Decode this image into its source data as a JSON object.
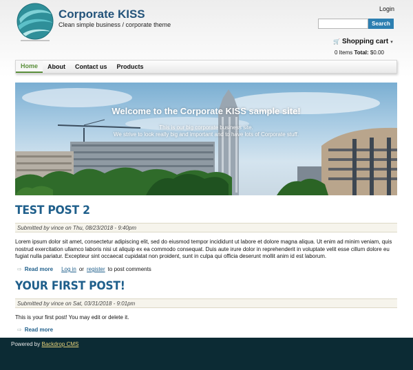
{
  "header": {
    "site_name": "Corporate KISS",
    "slogan": "Clean simple business / corporate theme",
    "login_label": "Login",
    "search": {
      "placeholder": "",
      "button_label": "Search"
    },
    "cart": {
      "title": "Shopping cart",
      "items_text": "0 Items",
      "total_label": "Total:",
      "total_value": "$0.00"
    },
    "icons": {
      "logo": "globe-logo",
      "cart": "cart-icon",
      "cart_toggle": "chevron-down-icon"
    }
  },
  "nav": {
    "items": [
      {
        "label": "Home",
        "active": true
      },
      {
        "label": "About",
        "active": false
      },
      {
        "label": "Contact us",
        "active": false
      },
      {
        "label": "Products",
        "active": false
      }
    ]
  },
  "hero": {
    "title": "Welcome to the Corporate KISS sample site!",
    "line1": "This is our big corporate business site.",
    "line2": "We strive to look really big and important and to have lots of Corporate stuff."
  },
  "posts": [
    {
      "title": "TEST POST 2",
      "meta": "Submitted by vince on Thu, 08/23/2018 - 9:40pm",
      "body": "Lorem ipsum dolor sit amet, consectetur adipiscing elit, sed do eiusmod tempor incididunt ut labore et dolore magna aliqua. Ut enim ad minim veniam, quis nostrud exercitation ullamco laboris nisi ut aliquip ex ea commodo consequat. Duis aute irure dolor in reprehenderit in voluptate velit esse cillum dolore eu fugiat nulla pariatur. Excepteur sint occaecat cupidatat non proident, sunt in culpa qui officia deserunt mollit anim id est laborum.",
      "read_more": "Read more",
      "login_link": "Log in",
      "or_text": "or",
      "register_link": "register",
      "comment_text": "to post comments"
    },
    {
      "title": "YOUR FIRST POST!",
      "meta": "Submitted by vince on Sat, 03/31/2018 - 9:01pm",
      "body": "This is your first post! You may edit or delete it.",
      "read_more": "Read more"
    }
  ],
  "footer": {
    "powered_by": "Powered by",
    "cms_link": "Backdrop CMS"
  },
  "colors": {
    "brand_blue": "#23537a",
    "link_blue": "#1f5f8b",
    "search_button": "#2d7fb1",
    "active_nav": "#5a8f3a",
    "footer_bg": "#0c2b34",
    "footer_link": "#e6d27a"
  }
}
